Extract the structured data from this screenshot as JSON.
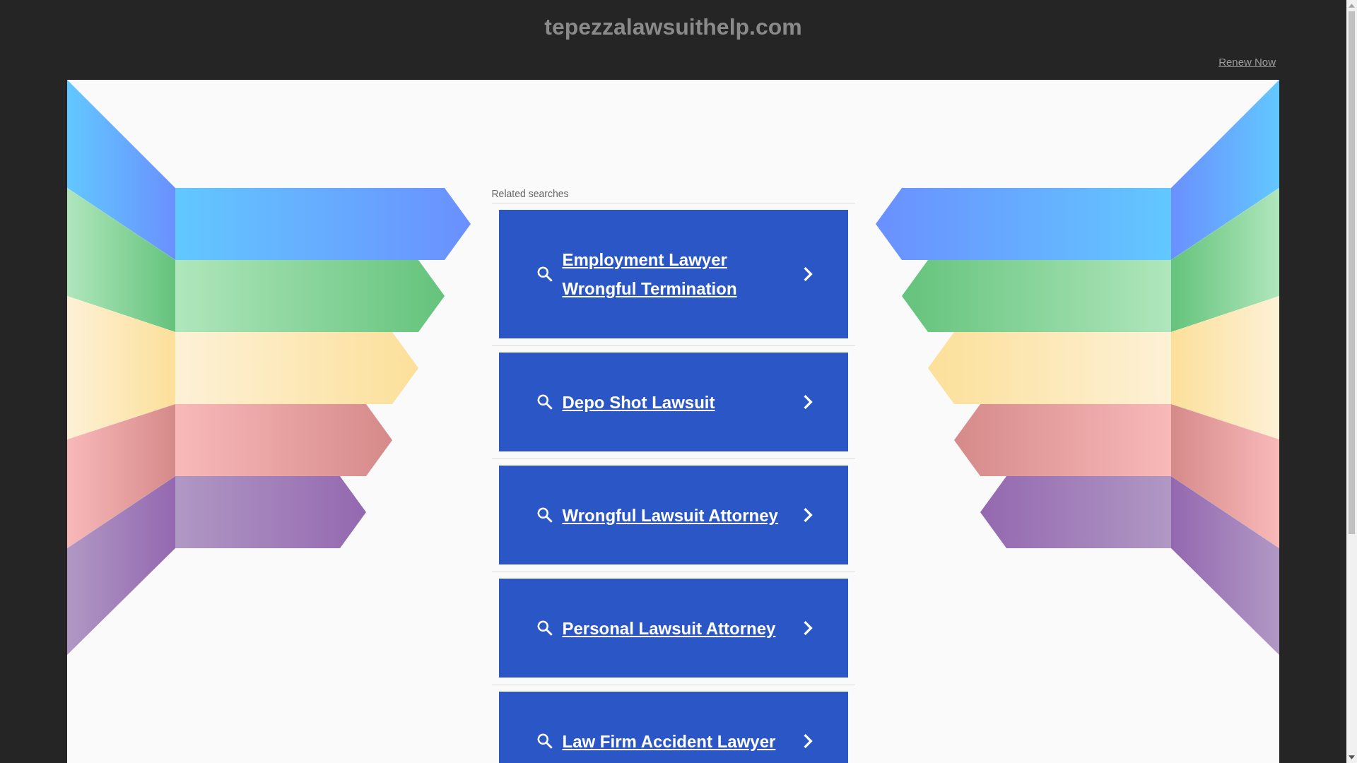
{
  "header": {
    "title": "tepezzalawsuithelp.com",
    "renew_link": "Renew Now"
  },
  "related_searches": {
    "heading": "Related searches",
    "items": [
      {
        "label": "Employment Lawyer Wrongful Termination"
      },
      {
        "label": "Depo Shot Lawsuit"
      },
      {
        "label": "Wrongful Lawsuit Attorney"
      },
      {
        "label": "Personal Lawsuit Attorney"
      },
      {
        "label": "Law Firm Accident Lawyer"
      }
    ]
  }
}
